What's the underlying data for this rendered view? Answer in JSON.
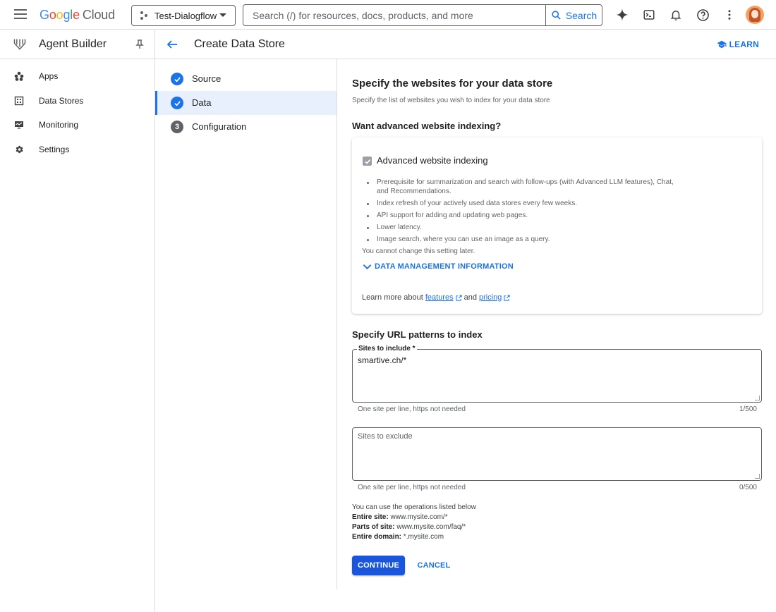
{
  "topbar": {
    "logo": {
      "g1": "G",
      "g2": "o",
      "g3": "o",
      "g4": "g",
      "g5": "l",
      "g6": "e",
      "cloud": "Cloud"
    },
    "project": "Test-Dialogflow",
    "search_placeholder": "Search (/) for resources, docs, products, and more",
    "search_button": "Search",
    "icons": [
      "gemini-sparkle-icon",
      "cloud-shell-icon",
      "notifications-icon",
      "help-icon",
      "more-vert-icon"
    ]
  },
  "sidebar": {
    "product": "Agent Builder",
    "items": [
      {
        "label": "Apps",
        "icon": "apps-icon"
      },
      {
        "label": "Data Stores",
        "icon": "data-stores-icon"
      },
      {
        "label": "Monitoring",
        "icon": "monitoring-icon"
      },
      {
        "label": "Settings",
        "icon": "settings-icon"
      }
    ]
  },
  "header": {
    "title": "Create Data Store",
    "learn": "LEARN"
  },
  "steps": [
    {
      "label": "Source",
      "state": "done"
    },
    {
      "label": "Data",
      "state": "active"
    },
    {
      "label": "Configuration",
      "state": "pending",
      "number": "3"
    }
  ],
  "main": {
    "title": "Specify the websites for your data store",
    "subtitle": "Specify the list of websites you wish to index for your data store",
    "advanced_heading": "Want advanced website indexing?",
    "checkbox_label": "Advanced website indexing",
    "checkbox_checked": true,
    "bullets": [
      "Prerequisite for summarization and search with follow-ups (with Advanced LLM features), Chat, and Recommendations.",
      "Index refresh of your actively used data stores every few weeks.",
      "API support for adding and updating web pages.",
      "Lower latency.",
      "Image search, where you can use an image as a query."
    ],
    "note": "You cannot change this setting later.",
    "data_mgmt": "DATA MANAGEMENT INFORMATION",
    "learn_more_prefix": "Learn more about",
    "learn_more_features": "features",
    "learn_more_and": "and",
    "learn_more_pricing": "pricing",
    "url_heading": "Specify URL patterns to index",
    "include": {
      "label": "Sites to include *",
      "value": "smartive.ch/*",
      "hint": "One site per line, https not needed",
      "count": "1/500"
    },
    "exclude": {
      "placeholder": "Sites to exclude",
      "value": "",
      "hint": "One site per line, https not needed",
      "count": "0/500"
    },
    "ops_intro": "You can use the operations listed below",
    "ops": [
      {
        "key": "Entire site:",
        "value": "www.mysite.com/*"
      },
      {
        "key": "Parts of site:",
        "value": "www.mysite.com/faq/*"
      },
      {
        "key": "Entire domain:",
        "value": "*.mysite.com"
      }
    ],
    "continue": "CONTINUE",
    "cancel": "CANCEL"
  },
  "colors": {
    "accent": "#1a73e8",
    "primary_button": "#1a56db",
    "active_step_bg": "#e8f0fe"
  }
}
